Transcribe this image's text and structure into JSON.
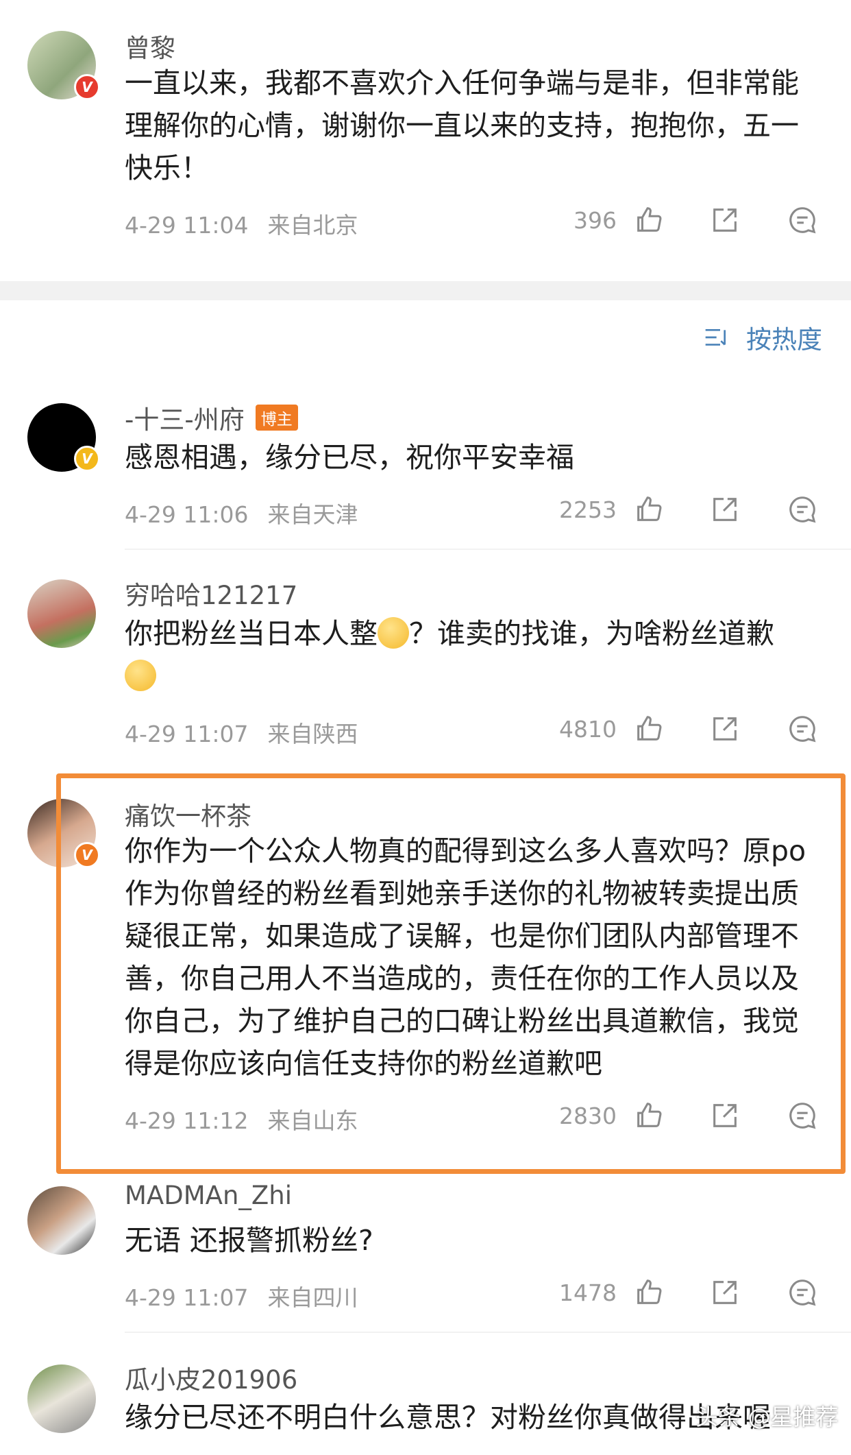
{
  "sort": {
    "label": "按热度"
  },
  "comments": [
    {
      "name": "曾黎",
      "text": "一直以来，我都不喜欢介入任何争端与是非，但非常能理解你的心情，谢谢你一直以来的支持，抱抱你，五一快乐！",
      "time": "4-29 11:04",
      "location": "来自北京",
      "likes": "396",
      "badge": "V"
    },
    {
      "name": "-十三-州府",
      "tag": "博主",
      "text": "感恩相遇，缘分已尽，祝你平安幸福",
      "time": "4-29 11:06",
      "location": "来自天津",
      "likes": "2253",
      "badge": "V"
    },
    {
      "name": "穷哈哈121217",
      "text": "你把粉丝当日本人整",
      "text2": "？谁卖的找谁，为啥粉丝道歉",
      "time": "4-29 11:07",
      "location": "来自陕西",
      "likes": "4810"
    },
    {
      "name": "痛饮一杯茶",
      "text": "你作为一个公众人物真的配得到这么多人喜欢吗？原po作为你曾经的粉丝看到她亲手送你的礼物被转卖提出质疑很正常，如果造成了误解，也是你们团队内部管理不善，你自己用人不当造成的，责任在你的工作人员以及你自己，为了维护自己的口碑让粉丝出具道歉信，我觉得是你应该向信任支持你的粉丝道歉吧",
      "time": "4-29 11:12",
      "location": "来自山东",
      "likes": "2830",
      "badge": "V"
    },
    {
      "name": "MADMAn_Zhi",
      "text": "无语 还报警抓粉丝?",
      "time": "4-29 11:07",
      "location": "来自四川",
      "likes": "1478"
    },
    {
      "name": "瓜小皮201906",
      "text": "缘分已尽还不明白什么意思？对粉丝你真做得出来喔"
    }
  ],
  "watermark": "头条 @星推荐",
  "colors": {
    "accent_blue": "#4a82b8",
    "highlight_orange": "#f28c38",
    "verified_red": "#e63b2e",
    "verified_gold": "#f3b81b"
  }
}
